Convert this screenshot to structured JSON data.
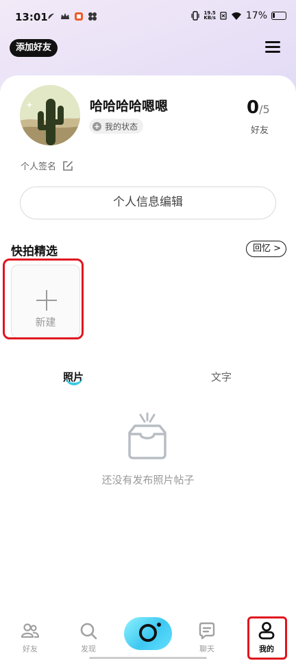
{
  "status_bar": {
    "time": "13:01",
    "speed_top": "19.5",
    "speed_unit": "KB/s",
    "battery": "17%"
  },
  "header": {
    "add_friend": "添加好友",
    "menu_icon": "menu-icon"
  },
  "profile": {
    "username": "哈哈哈哈嗯嗯",
    "status_label": "我的状态",
    "friend_count": "0",
    "friend_limit": "/5",
    "friend_label": "好友",
    "signature": "个人签名",
    "edit_profile": "个人信息编辑"
  },
  "quick_snap": {
    "title": "快拍精选",
    "memory_button": "回忆 >",
    "new_label": "新建"
  },
  "tabs": [
    {
      "label": "照片",
      "active": true
    },
    {
      "label": "文字",
      "active": false
    }
  ],
  "empty_state": {
    "message": "还没有发布照片帖子"
  },
  "bottom_nav": [
    {
      "label": "好友",
      "icon": "friends-icon"
    },
    {
      "label": "发现",
      "icon": "search-icon"
    },
    {
      "label": "",
      "icon": "camera-icon"
    },
    {
      "label": "聊天",
      "icon": "chat-icon"
    },
    {
      "label": "我的",
      "icon": "profile-icon",
      "active": true
    }
  ],
  "colors": {
    "accent": "#29c4e3",
    "highlight_box": "#e0141e"
  }
}
